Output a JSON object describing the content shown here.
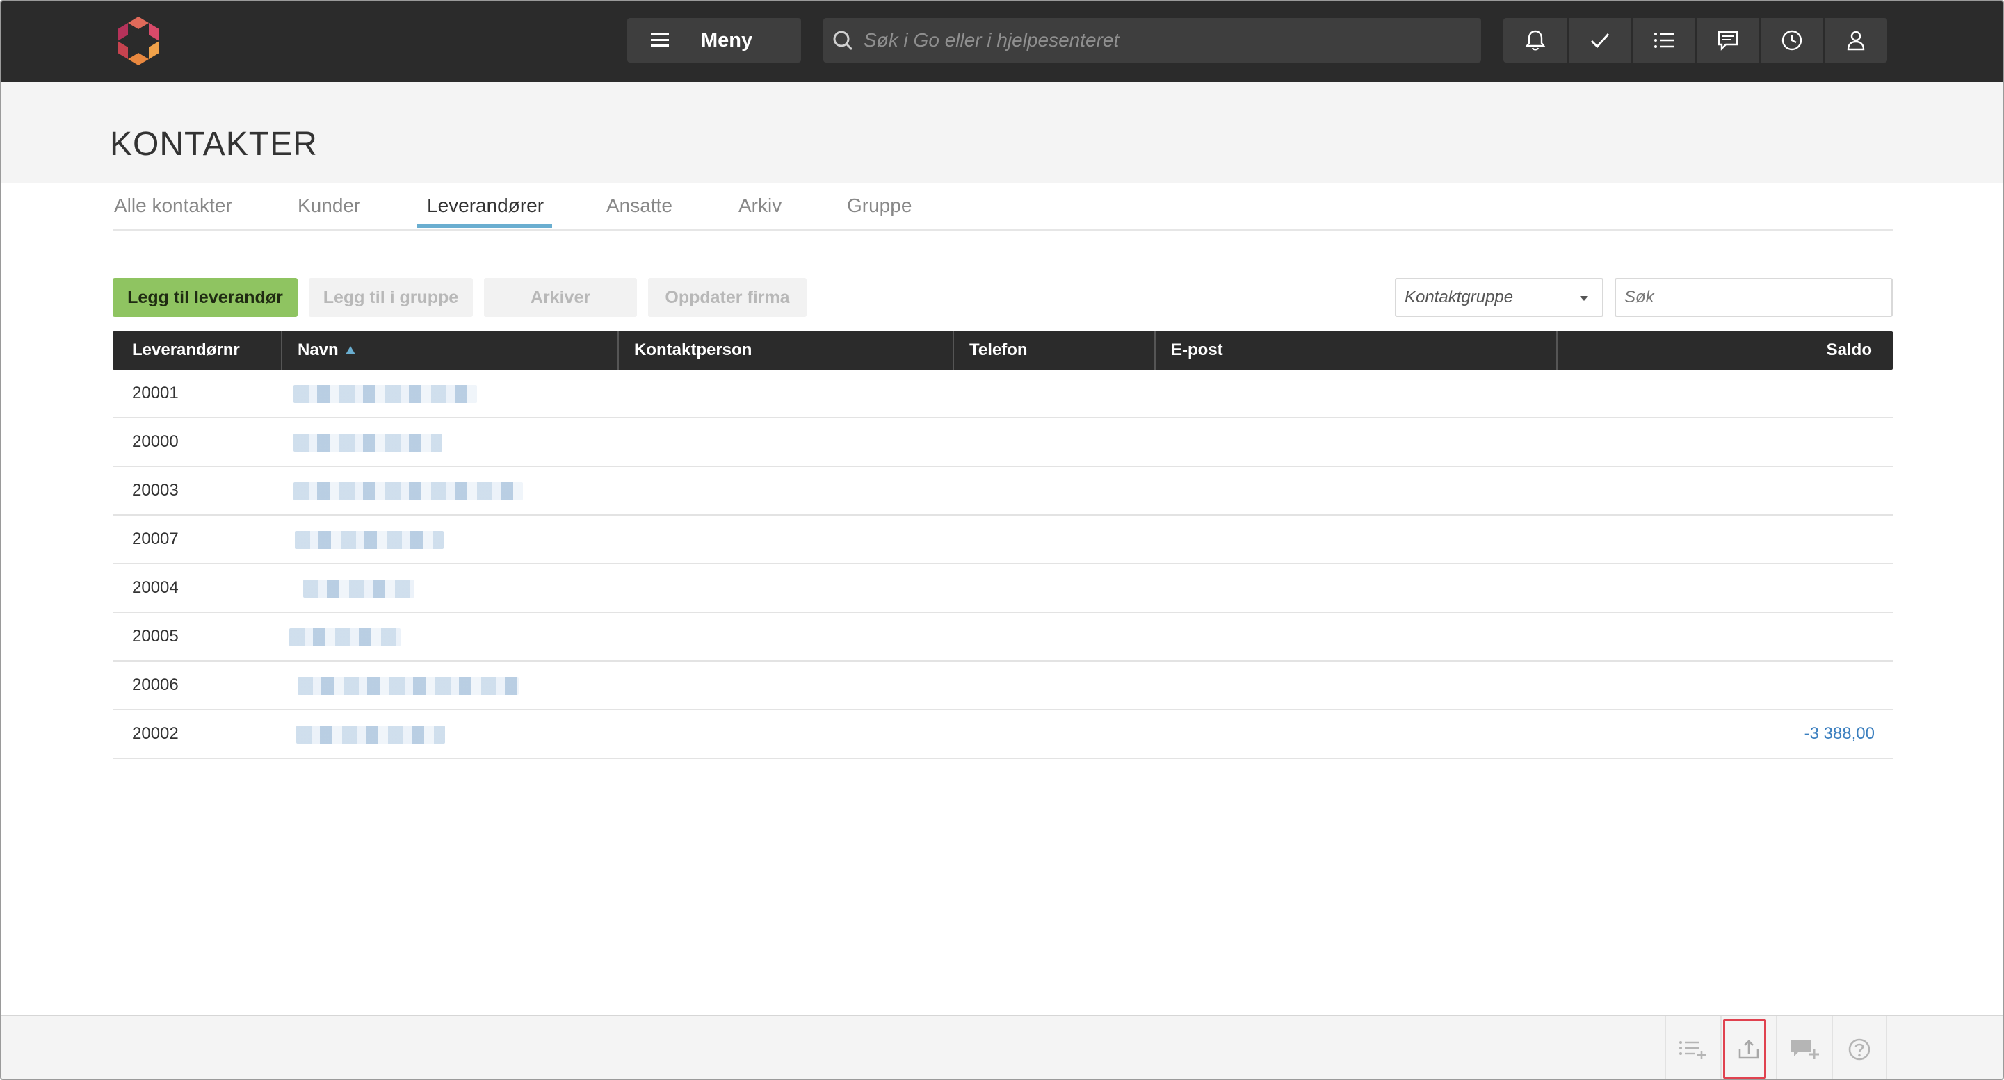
{
  "topbar": {
    "menu_label": "Meny",
    "search_placeholder": "Søk i Go eller i hjelpesenteret",
    "icons": [
      "bell-icon",
      "check-icon",
      "list-icon",
      "chat-icon",
      "clock-icon",
      "user-icon"
    ]
  },
  "page": {
    "title": "KONTAKTER"
  },
  "tabs": [
    {
      "label": "Alle kontakter",
      "active": false
    },
    {
      "label": "Kunder",
      "active": false
    },
    {
      "label": "Leverandører",
      "active": true
    },
    {
      "label": "Ansatte",
      "active": false
    },
    {
      "label": "Arkiv",
      "active": false
    },
    {
      "label": "Gruppe",
      "active": false
    }
  ],
  "actions": {
    "add_supplier": "Legg til leverandør",
    "add_to_group": "Legg til i gruppe",
    "archive": "Arkiver",
    "update_company": "Oppdater firma"
  },
  "filters": {
    "group_dropdown": "Kontaktgruppe",
    "search_placeholder": "Søk"
  },
  "table": {
    "columns": [
      "Leverandørnr",
      "Navn",
      "Kontaktperson",
      "Telefon",
      "E-post",
      "Saldo"
    ],
    "sort_column": "Navn",
    "sort_direction": "ascending",
    "rows": [
      {
        "nr": "20001",
        "name": "[redacted]",
        "contact": "",
        "phone": "",
        "email": "",
        "saldo": ""
      },
      {
        "nr": "20000",
        "name": "[redacted]",
        "contact": "",
        "phone": "",
        "email": "",
        "saldo": ""
      },
      {
        "nr": "20003",
        "name": "[redacted]",
        "contact": "",
        "phone": "",
        "email": "",
        "saldo": ""
      },
      {
        "nr": "20007",
        "name": "[redacted]",
        "contact": "",
        "phone": "",
        "email": "",
        "saldo": ""
      },
      {
        "nr": "20004",
        "name": "[redacted]",
        "contact": "",
        "phone": "",
        "email": "",
        "saldo": ""
      },
      {
        "nr": "20005",
        "name": "[redacted]",
        "contact": "",
        "phone": "",
        "email": "",
        "saldo": ""
      },
      {
        "nr": "20006",
        "name": "[redacted]",
        "contact": "",
        "phone": "",
        "email": "",
        "saldo": ""
      },
      {
        "nr": "20002",
        "name": "[redacted]",
        "contact": "",
        "phone": "",
        "email": "",
        "saldo": "-3 388,00"
      }
    ]
  },
  "bottombar": {
    "icons": [
      "add-list-icon",
      "export-icon",
      "add-comment-icon",
      "help-icon"
    ],
    "highlighted": "export-icon"
  },
  "colors": {
    "topbar": "#2b2b2b",
    "primary_button": "#8fc461",
    "tab_accent": "#6aaed0",
    "negative_amount": "#3b7fbf",
    "highlight": "#e0424f"
  }
}
